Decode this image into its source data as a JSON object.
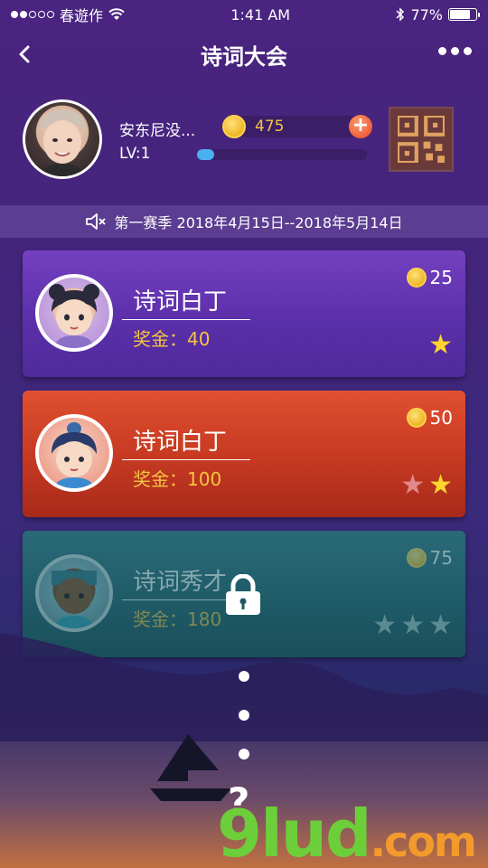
{
  "status": {
    "carrier": "春遊作",
    "time": "1:41 AM",
    "battery": "77%",
    "battery_level": 0.77
  },
  "nav": {
    "title": "诗词大会"
  },
  "profile": {
    "name": "安东尼没...",
    "level": "LV:1",
    "coins": "475",
    "xp_progress": 0.1
  },
  "season": {
    "text": "第一赛季 2018年4月15日--2018年5月14日"
  },
  "levels": [
    {
      "title": "诗词白丁",
      "prize": "奖金：40",
      "cost": "25",
      "stars_on": 1,
      "stars_total": 1,
      "locked": false
    },
    {
      "title": "诗词白丁",
      "prize": "奖金：100",
      "cost": "50",
      "stars_on": 1,
      "stars_total": 2,
      "locked": false
    },
    {
      "title": "诗词秀才",
      "prize": "奖金：180",
      "cost": "75",
      "stars_on": 0,
      "stars_total": 3,
      "locked": true
    }
  ],
  "more": {
    "question_mark": "?"
  },
  "watermark": {
    "brand": "9lud",
    "suffix": ".com"
  },
  "colors": {
    "accent_gold": "#f4c542",
    "star_on": "#ffd52e",
    "level1": "#5a2ea8",
    "level2": "#c83a22",
    "level3": "#1e5a66"
  }
}
